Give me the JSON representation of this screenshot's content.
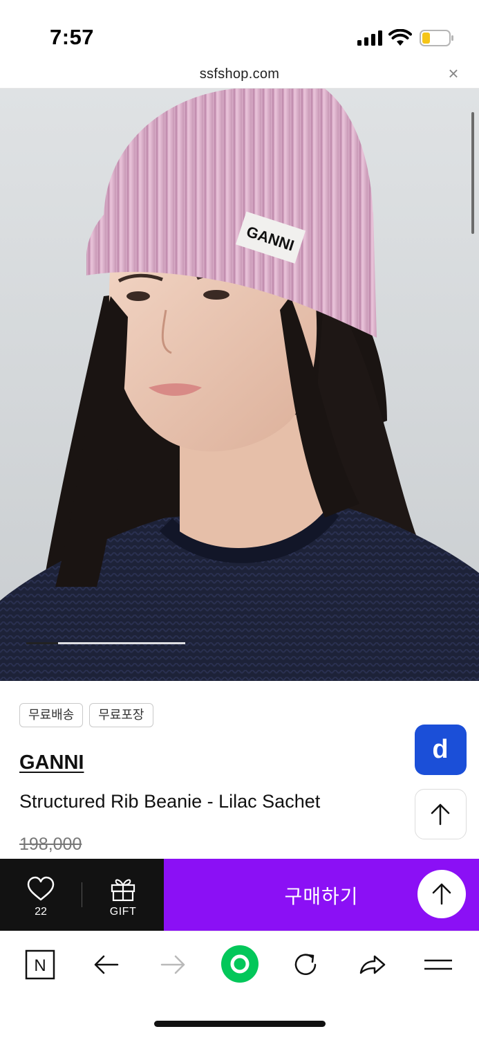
{
  "status_bar": {
    "time": "7:57",
    "icons": [
      "signal-icon",
      "wifi-icon",
      "battery-low-icon"
    ],
    "battery_color": "#f5c518"
  },
  "browser": {
    "url": "ssfshop.com",
    "close_icon": "close-icon"
  },
  "hero": {
    "image_label": "GANNI",
    "carousel": {
      "current": 1,
      "total": 5
    }
  },
  "product": {
    "badges": [
      "무료배송",
      "무료포장"
    ],
    "brand": "GANNI",
    "name": "Structured Rib Beanie - Lilac Sachet",
    "original_price": "198,000"
  },
  "floating_buttons": {
    "app_icon": "d-app-icon",
    "app_label": "d",
    "app_color": "#1b4fd8",
    "scroll_top_icon": "arrow-up-icon"
  },
  "purchase_bar": {
    "wish_icon": "heart-icon",
    "wish_count": "22",
    "gift_icon": "gift-icon",
    "gift_label": "GIFT",
    "buy_label": "구매하기",
    "buy_color": "#8b10f5",
    "scroll_top_icon": "arrow-up-icon"
  },
  "toolbar": {
    "items": [
      "naver-n-icon",
      "back-arrow-icon",
      "forward-arrow-icon",
      "green-dot-icon",
      "reload-icon",
      "share-icon",
      "menu-icon"
    ],
    "n_label": "N",
    "green_color": "#03c75a"
  }
}
